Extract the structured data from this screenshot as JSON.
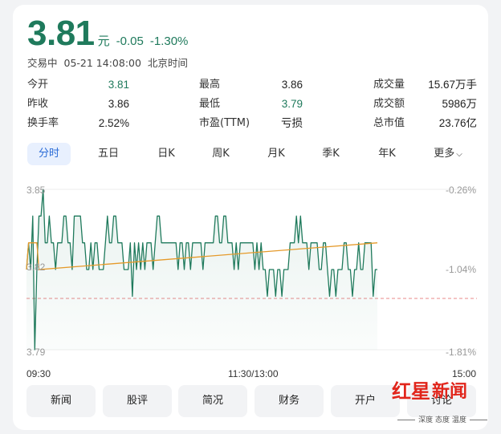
{
  "quote": {
    "price": "3.81",
    "unit": "元",
    "change": "-0.05",
    "change_pct": "-1.30%",
    "status": "交易中",
    "datetime": "05-21 14:08:00",
    "timezone": "北京时间"
  },
  "stats": [
    [
      {
        "label": "今开",
        "value": "3.81",
        "color": "#1f7a5c"
      },
      {
        "label": "最高",
        "value": "3.86"
      },
      {
        "label": "成交量",
        "value": "15.67万手"
      }
    ],
    [
      {
        "label": "昨收",
        "value": "3.86"
      },
      {
        "label": "最低",
        "value": "3.79",
        "color": "#1f7a5c"
      },
      {
        "label": "成交额",
        "value": "5986万"
      }
    ],
    [
      {
        "label": "换手率",
        "value": "2.52%"
      },
      {
        "label": "市盈(TTM)",
        "value": "亏损"
      },
      {
        "label": "总市值",
        "value": "23.76亿"
      }
    ]
  ],
  "tabs": [
    "分时",
    "五日",
    "日K",
    "周K",
    "月K",
    "季K",
    "年K",
    "更多"
  ],
  "active_tab": "分时",
  "chart_data": {
    "type": "line",
    "y_left_ticks": [
      "3.85",
      "3.82",
      "3.79"
    ],
    "y_right_ticks": [
      "-0.26%",
      "-1.04%",
      "-1.81%"
    ],
    "x_ticks": [
      "09:30",
      "11:30/13:00",
      "15:00"
    ],
    "ylim": [
      3.79,
      3.85
    ],
    "prev_close": 3.82,
    "series": [
      {
        "color": "#1f7a5c",
        "values": [
          3.82,
          3.83,
          3.82,
          3.84,
          3.79,
          3.82,
          3.84,
          3.84,
          3.85,
          3.83,
          3.83,
          3.84,
          3.83,
          3.83,
          3.82,
          3.83,
          3.83,
          3.83,
          3.84,
          3.84,
          3.83,
          3.83,
          3.82,
          3.84,
          3.84,
          3.84,
          3.84,
          3.83,
          3.83,
          3.82,
          3.82,
          3.83,
          3.82,
          3.83,
          3.83,
          3.82,
          3.82,
          3.82,
          3.83,
          3.84,
          3.83,
          3.83,
          3.84,
          3.84,
          3.83,
          3.83,
          3.83,
          3.82,
          3.82,
          3.82,
          3.83,
          3.81,
          3.83,
          3.82,
          3.83,
          3.82,
          3.83,
          3.82,
          3.83,
          3.83,
          3.83,
          3.82,
          3.83,
          3.84,
          3.84,
          3.83,
          3.83,
          3.83,
          3.83,
          3.83,
          3.83,
          3.83,
          3.83,
          3.82,
          3.83,
          3.83,
          3.82,
          3.83,
          3.83,
          3.82,
          3.83,
          3.83,
          3.83,
          3.83,
          3.83,
          3.82,
          3.83,
          3.83,
          3.83,
          3.83,
          3.83,
          3.84,
          3.84,
          3.83,
          3.83,
          3.84,
          3.84,
          3.83,
          3.83,
          3.83,
          3.82,
          3.83,
          3.82,
          3.83,
          3.83,
          3.83,
          3.83,
          3.83,
          3.83,
          3.83,
          3.82,
          3.83,
          3.82,
          3.83,
          3.82,
          3.82,
          3.81,
          3.82,
          3.82,
          3.82,
          3.81,
          3.82,
          3.82,
          3.81,
          3.82,
          3.82,
          3.82,
          3.83,
          3.83,
          3.83,
          3.84,
          3.83,
          3.84,
          3.83,
          3.83,
          3.83,
          3.82,
          3.83,
          3.83,
          3.83,
          3.83,
          3.82,
          3.82,
          3.83,
          3.83,
          3.82,
          3.81,
          3.82,
          3.82,
          3.81,
          3.82,
          3.82,
          3.82,
          3.83,
          3.83,
          3.82,
          3.82,
          3.81,
          3.82,
          3.82,
          3.83,
          3.82,
          3.82,
          3.83,
          3.83,
          3.83,
          3.83,
          3.81,
          3.82,
          3.82
        ]
      },
      {
        "color": "#e59a2a",
        "values": [
          3.82,
          3.83,
          3.83,
          3.83,
          3.83,
          3.83,
          3.82
        ]
      }
    ]
  },
  "buttons": [
    "新闻",
    "股评",
    "简况",
    "财务",
    "开户",
    "讨论"
  ],
  "watermark": {
    "logo": "红星",
    "news": "新闻",
    "tagline": "深度 态度 温度"
  }
}
